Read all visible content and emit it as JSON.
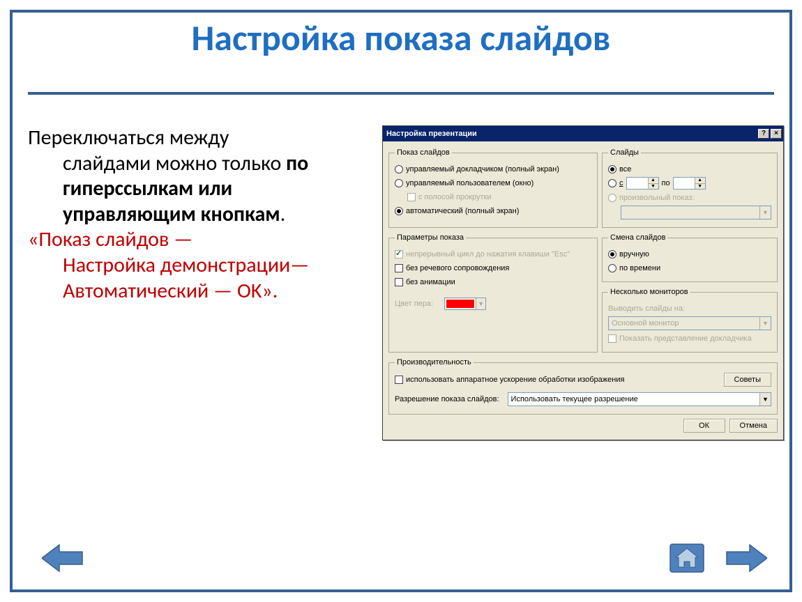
{
  "slide": {
    "title": "Настройка показа слайдов",
    "text": {
      "line1": "Переключаться между",
      "line2_indent": "слайдами можно только ",
      "line2b_bold": "по гиперссылкам или управляющим кнопкам",
      "line2c": ".",
      "red1": "«Показ слайдов —",
      "red2_indent": "Настройка демонстрации— Автоматический — OK»."
    }
  },
  "dialog": {
    "title": "Настройка презентации",
    "groups": {
      "show": {
        "legend": "Показ слайдов",
        "r1": "управляемый докладчиком (полный экран)",
        "r2": "управляемый пользователем (окно)",
        "r2sub": "с полосой прокрутки",
        "r3": "автоматический (полный экран)"
      },
      "slides": {
        "legend": "Слайды",
        "r1": "все",
        "r2_from": "с",
        "r2_to": "по",
        "r3": "произвольный показ:"
      },
      "options": {
        "legend": "Параметры показа",
        "c1": "непрерывный цикл до нажатия клавиши \"Esc\"",
        "c2": "без речевого сопровождения",
        "c3": "без анимации",
        "pen_label": "Цвет пера:"
      },
      "advance": {
        "legend": "Смена слайдов",
        "r1": "вручную",
        "r2": "по времени"
      },
      "monitors": {
        "legend": "Несколько мониторов",
        "lbl": "Выводить слайды на:",
        "combo": "Основной монитор",
        "chk": "Показать представление докладчика"
      },
      "perf": {
        "legend": "Производительность",
        "chk": "использовать аппаратное ускорение обработки изображения",
        "tips_btn": "Советы",
        "res_label": "Разрешение показа слайдов:",
        "res_combo": "Использовать текущее разрешение"
      }
    },
    "buttons": {
      "ok": "ОК",
      "cancel": "Отмена"
    }
  }
}
